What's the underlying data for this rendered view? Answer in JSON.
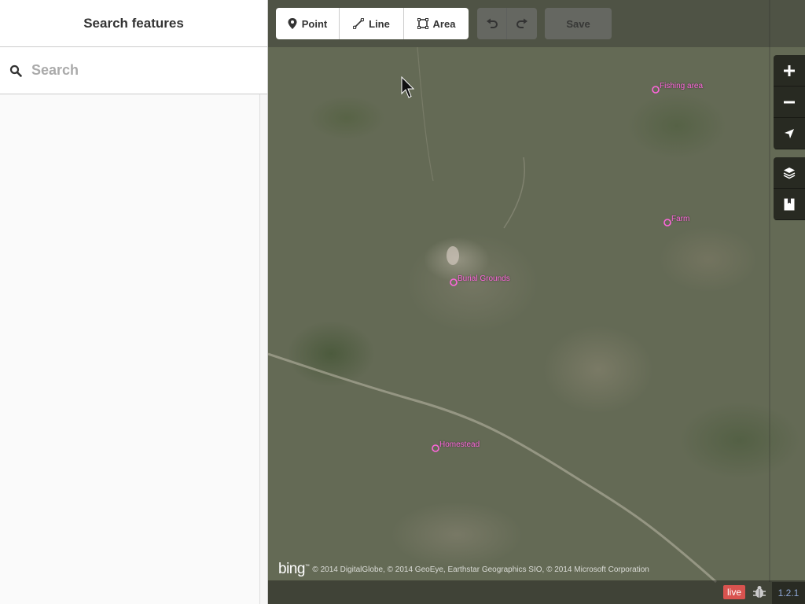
{
  "sidebar": {
    "title": "Search features",
    "search": {
      "placeholder": "Search",
      "value": "",
      "icon": "search-icon"
    }
  },
  "toolbar": {
    "modes": [
      {
        "label": "Point",
        "icon": "point-marker-icon"
      },
      {
        "label": "Line",
        "icon": "line-icon"
      },
      {
        "label": "Area",
        "icon": "area-icon"
      }
    ],
    "undo_icon": "undo-icon",
    "redo_icon": "redo-icon",
    "save_label": "Save"
  },
  "map_controls": [
    "zoom-in-icon",
    "zoom-out-icon",
    "geolocate-icon",
    "layers-icon",
    "map-data-icon"
  ],
  "features": [
    {
      "name": "Fishing area"
    },
    {
      "name": "Farm"
    },
    {
      "name": "Burial Grounds"
    },
    {
      "name": "Homestead"
    }
  ],
  "attribution": {
    "logo": "bing",
    "text": "© 2014 DigitalGlobe, © 2014 GeoEye, Earthstar Geographics SIO, © 2014 Microsoft Corporation"
  },
  "footer": {
    "live_label": "live",
    "version": "1.2.1"
  },
  "colors": {
    "feature_label": "#ff66dd",
    "live_badge": "#d9534f",
    "version_text": "#8fa8d8"
  }
}
